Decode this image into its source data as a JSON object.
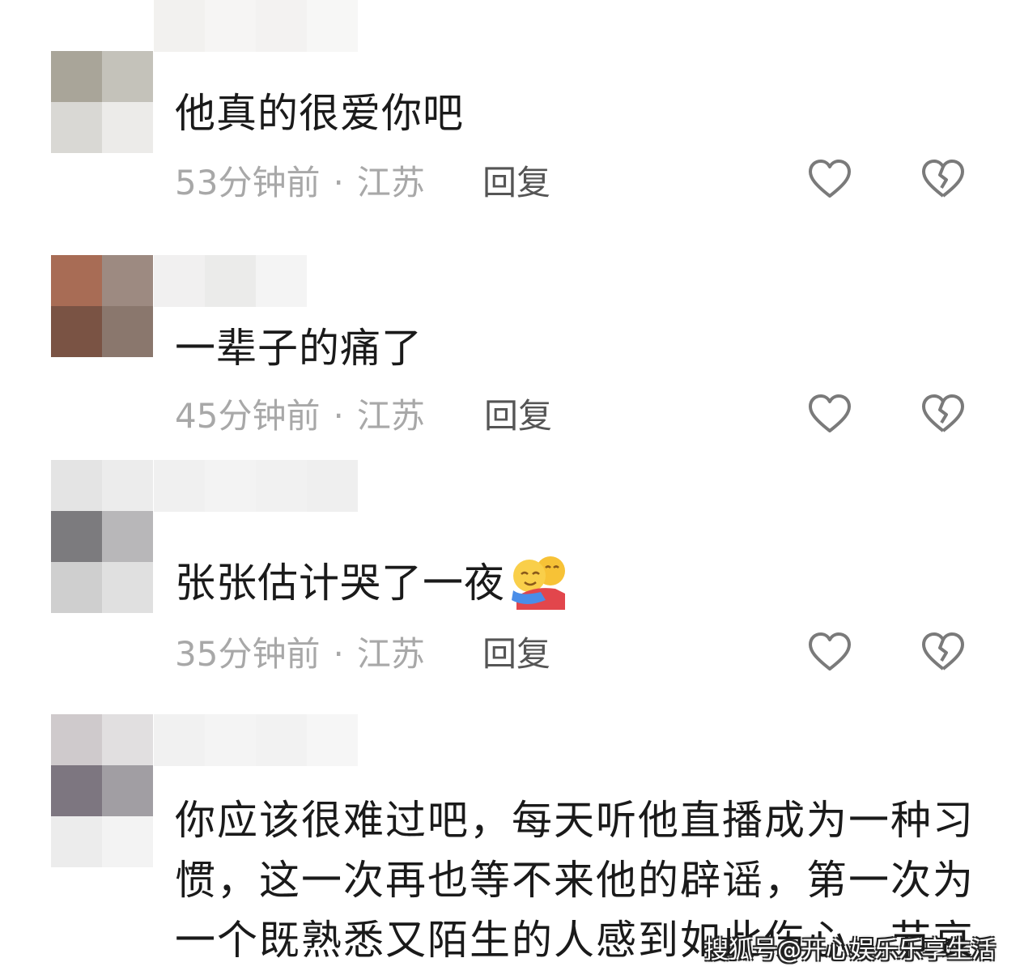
{
  "comments": [
    {
      "text": "他真的很爱你吧",
      "time": "53分钟前",
      "separator": "·",
      "location": "江苏",
      "reply_label": "回复",
      "like_icon": "heart-outline-icon",
      "dislike_icon": "broken-heart-icon",
      "avatar_colors": [
        "#d8d4cf",
        "#e6e3df",
        "#a9a599",
        "#c4c2ba"
      ]
    },
    {
      "text": "一辈子的痛了",
      "time": "45分钟前",
      "separator": "·",
      "location": "江苏",
      "reply_label": "回复",
      "like_icon": "heart-outline-icon",
      "dislike_icon": "broken-heart-icon",
      "avatar_colors": [
        "#a86c55",
        "#9d8a81",
        "#7a5344",
        "#8a776d"
      ]
    },
    {
      "text": "张张估计哭了一夜",
      "emoji": "hugging-face-emoji",
      "time": "35分钟前",
      "separator": "·",
      "location": "江苏",
      "reply_label": "回复",
      "like_icon": "heart-outline-icon",
      "dislike_icon": "broken-heart-icon",
      "avatar_colors": [
        "#e6e6e6",
        "#ededed",
        "#7c7b7e",
        "#b8b7b9"
      ]
    },
    {
      "text": "你应该很难过吧，每天听他直播成为一种习惯，这一次再也等不来他的辟谣，第一次为一个既熟悉又陌生的人感到如此伤心，节哀",
      "avatar_colors": [
        "#cfcacc",
        "#e1dfe0",
        "#7d7680",
        "#a19ea3"
      ]
    }
  ],
  "watermark": "搜狐号@开心娱乐乐享生活"
}
